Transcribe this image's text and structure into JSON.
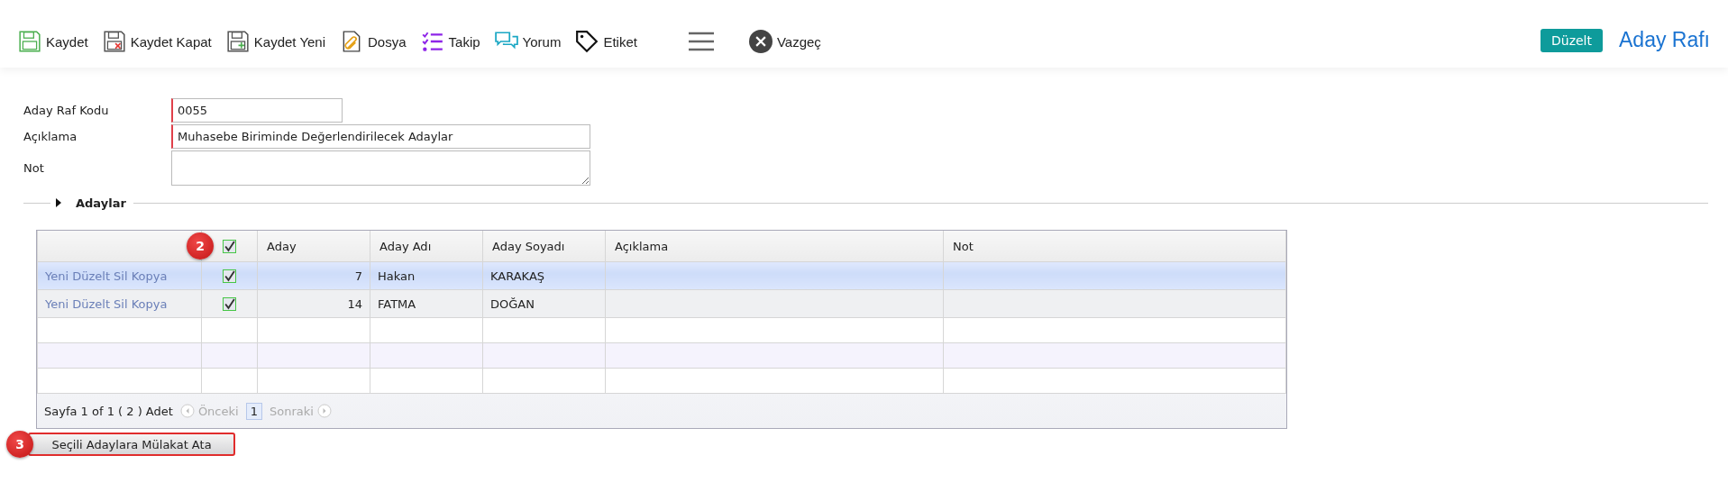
{
  "toolbar": {
    "items": [
      {
        "kind": "save",
        "label": "Kaydet"
      },
      {
        "kind": "save-close",
        "label": "Kaydet Kapat"
      },
      {
        "kind": "save-new",
        "label": "Kaydet Yeni"
      },
      {
        "kind": "file",
        "label": "Dosya"
      },
      {
        "kind": "track",
        "label": "Takip"
      },
      {
        "kind": "comment",
        "label": "Yorum"
      },
      {
        "kind": "tag",
        "label": "Etiket"
      }
    ],
    "cancel": "Vazgeç",
    "mode_badge": "Düzelt",
    "page_title": "Aday Rafı"
  },
  "form": {
    "fields": [
      {
        "kind": "input",
        "label": "Aday Raf Kodu",
        "value": "0055",
        "required": true
      },
      {
        "kind": "input",
        "label": "Açıklama",
        "value": "Muhasebe Biriminde Değerlendirilecek Adaylar",
        "required": true
      },
      {
        "kind": "textarea",
        "label": "Not",
        "required": false
      }
    ]
  },
  "section": {
    "title": "Adaylar",
    "expanded": false
  },
  "table": {
    "header_checked": true,
    "header_badge": "2",
    "columns": [
      "Aday",
      "Aday Adı",
      "Aday Soyadı",
      "Açıklama",
      "Not"
    ],
    "rows": [
      {
        "actions": "Yeni Düzelt Sil Kopya",
        "checked": true,
        "selected": true,
        "cells": [
          "7",
          "Hakan",
          "KARAKAŞ"
        ]
      },
      {
        "actions": "Yeni Düzelt Sil Kopya",
        "checked": true,
        "selected": false,
        "cells": [
          "14",
          "FATMA",
          "DOĞAN"
        ]
      }
    ],
    "pager": {
      "summary": "Sayfa 1 of 1 ( 2 ) Adet",
      "prev": "Önceki",
      "prev_disabled": true,
      "pages": [
        {
          "label": "1",
          "selected": true
        }
      ],
      "next": "Sonraki",
      "next_disabled": true
    }
  },
  "assign_button": {
    "label": "Seçili Adaylara Mülakat Ata",
    "badge": "3"
  }
}
